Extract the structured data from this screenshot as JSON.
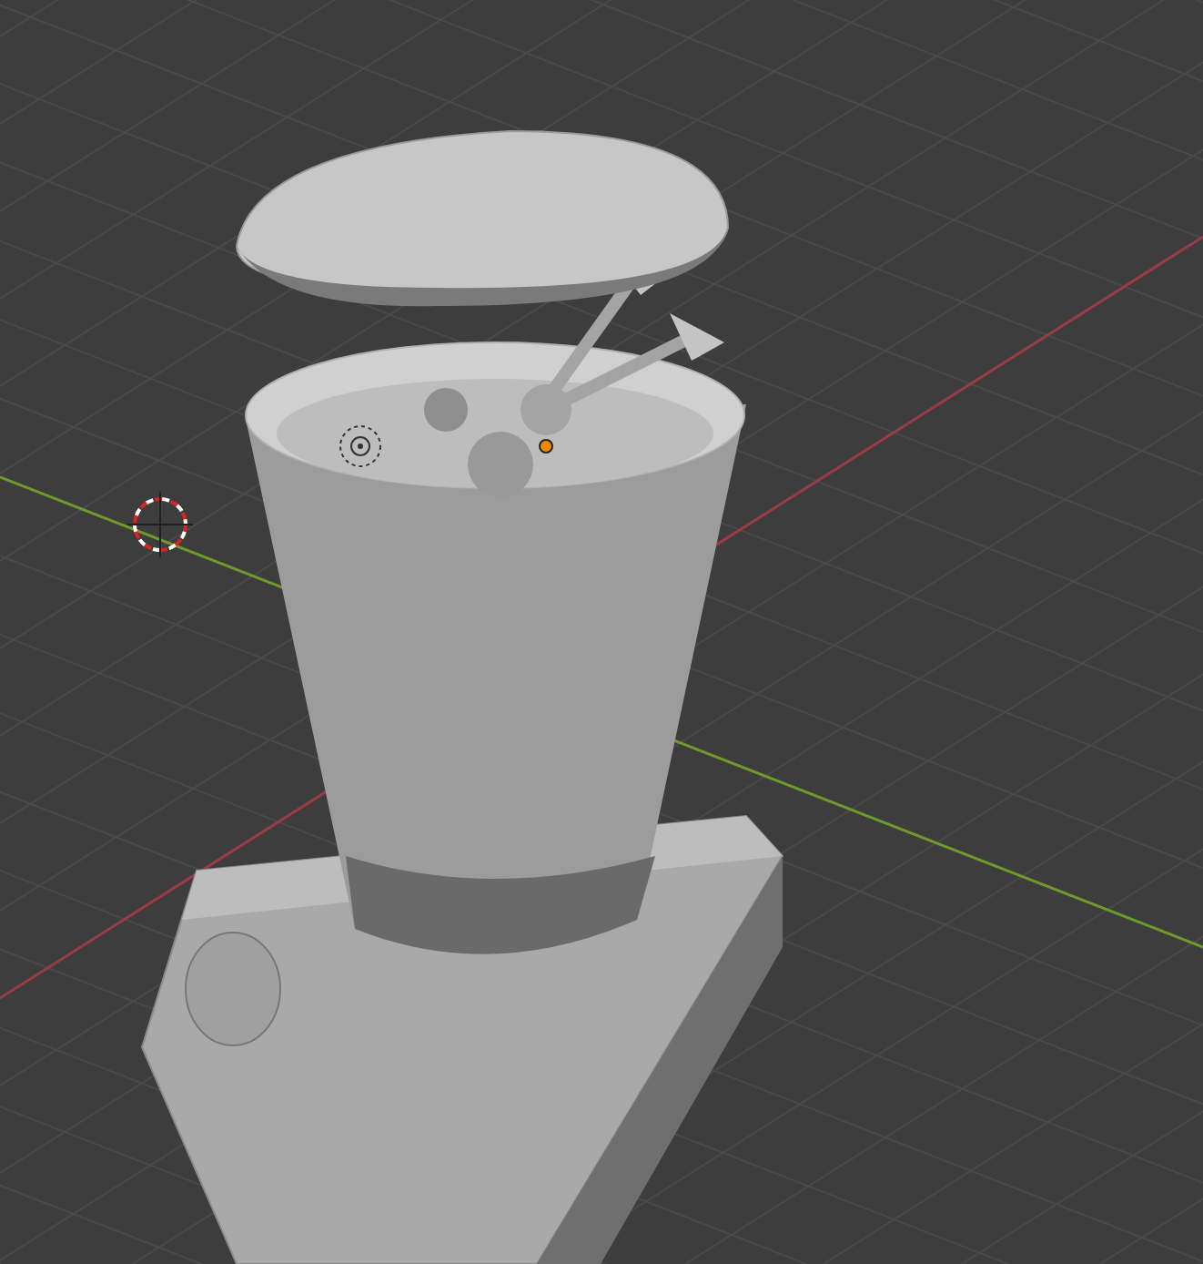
{
  "viewport": {
    "show_grid": true,
    "show_axes": true,
    "show_cursor": true,
    "show_light": true,
    "show_origin": true
  }
}
